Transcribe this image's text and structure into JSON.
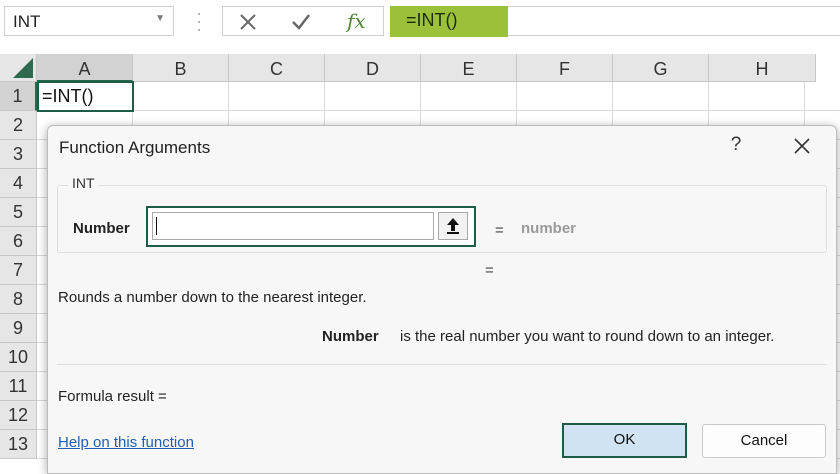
{
  "formula_bar": {
    "name_box": "INT",
    "formula": "=INT()"
  },
  "grid": {
    "columns": [
      "A",
      "B",
      "C",
      "D",
      "E",
      "F",
      "G",
      "H"
    ],
    "rows": [
      "1",
      "2",
      "3",
      "4",
      "5",
      "6",
      "7",
      "8",
      "9",
      "10",
      "11",
      "12",
      "13"
    ],
    "selected_cell_content": "=INT()"
  },
  "dialog": {
    "title": "Function Arguments",
    "help_button": "?",
    "function_name": "INT",
    "argument_label": "Number",
    "argument_value": "",
    "equals": "=",
    "argument_hint": "number",
    "result_equals": "=",
    "description": "Rounds a number down to the nearest integer.",
    "arg_desc_name": "Number",
    "arg_desc_text": "is the real number you want to round down to an integer.",
    "formula_result_label": "Formula result =",
    "help_link": "Help on this function",
    "ok_label": "OK",
    "cancel_label": "Cancel"
  },
  "colors": {
    "formula_chip": "#9bc13b",
    "selection_border": "#1f5c45",
    "ok_button_bg": "#cfe3f2",
    "link": "#1f5fb0"
  }
}
